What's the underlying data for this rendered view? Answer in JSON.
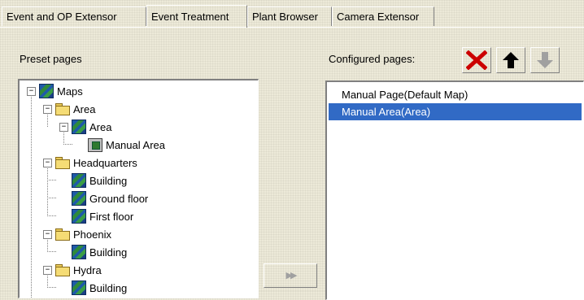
{
  "tabs": [
    {
      "label": "Event and OP Extensor",
      "active": false
    },
    {
      "label": "Event Treatment",
      "active": true
    },
    {
      "label": "Plant Browser",
      "active": false
    },
    {
      "label": "Camera Extensor",
      "active": false
    }
  ],
  "preset": {
    "label": "Preset pages",
    "tree": [
      {
        "label": "Maps",
        "icon": "map-icon",
        "expanded": true
      },
      {
        "label": "Area",
        "icon": "folder-icon",
        "expanded": true
      },
      {
        "label": "Area",
        "icon": "map-icon",
        "expanded": true
      },
      {
        "label": "Manual Area",
        "icon": "page-icon"
      },
      {
        "label": "Headquarters",
        "icon": "folder-icon",
        "expanded": true
      },
      {
        "label": "Building",
        "icon": "map-icon"
      },
      {
        "label": "Ground floor",
        "icon": "map-icon"
      },
      {
        "label": "First floor",
        "icon": "map-icon"
      },
      {
        "label": "Phoenix",
        "icon": "folder-icon",
        "expanded": true
      },
      {
        "label": "Building",
        "icon": "map-icon"
      },
      {
        "label": "Hydra",
        "icon": "folder-icon",
        "expanded": true
      },
      {
        "label": "Building",
        "icon": "map-icon"
      }
    ]
  },
  "configured": {
    "label": "Configured pages:",
    "items": [
      {
        "label": "Manual Page(Default Map)",
        "selected": false
      },
      {
        "label": "Manual Area(Area)",
        "selected": true
      }
    ]
  },
  "toolbar": {
    "delete_icon": "delete-x-icon",
    "up_icon": "arrow-up-icon",
    "down_icon": "arrow-down-icon",
    "delete_color": "#cc0000",
    "down_enabled": false
  },
  "add_button": {
    "icon": "double-chevron-right-icon",
    "enabled": false
  },
  "colors": {
    "selection": "#316ac5",
    "background": "#ece9d8"
  }
}
